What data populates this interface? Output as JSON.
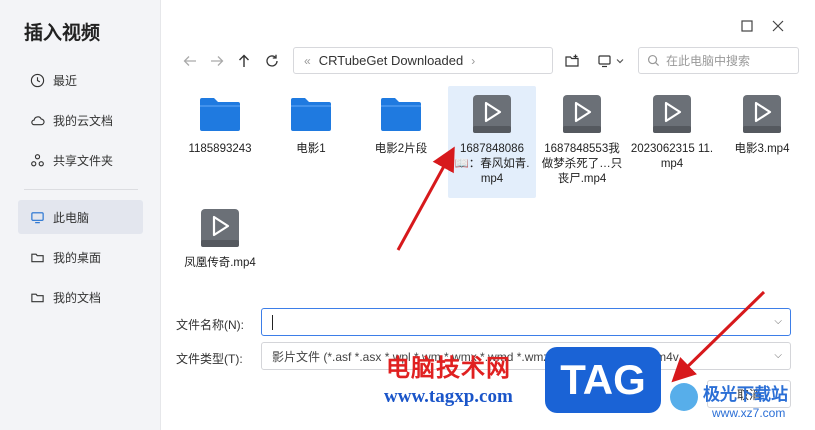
{
  "dialog": {
    "title": "插入视频"
  },
  "sidebar": {
    "items": [
      {
        "label": "最近",
        "icon": "clock-icon"
      },
      {
        "label": "我的云文档",
        "icon": "cloud-icon"
      },
      {
        "label": "共享文件夹",
        "icon": "share-icon"
      },
      {
        "label": "此电脑",
        "icon": "computer-icon",
        "active": true
      },
      {
        "label": "我的桌面",
        "icon": "folder-icon"
      },
      {
        "label": "我的文档",
        "icon": "folder-icon"
      }
    ]
  },
  "toolbar": {
    "path_prefix": "«",
    "path": "CRTubeGet Downloaded",
    "path_suffix": "›",
    "search_placeholder": "在此电脑中搜索"
  },
  "files": [
    {
      "name": "1185893243",
      "type": "folder"
    },
    {
      "name": "电影1",
      "type": "folder"
    },
    {
      "name": "电影2片段",
      "type": "folder"
    },
    {
      "name": "1687848086📖：春风如青.mp4",
      "type": "video",
      "selected": true
    },
    {
      "name": "1687848553我做梦杀死了…只丧尸.mp4",
      "type": "video"
    },
    {
      "name": "2023062315 11.mp4",
      "type": "video"
    },
    {
      "name": "电影3.mp4",
      "type": "video"
    },
    {
      "name": "凤凰传奇.mp4",
      "type": "video"
    }
  ],
  "form": {
    "filename_label": "文件名称(N):",
    "filename_value": "",
    "filetype_label": "文件类型(T):",
    "filetype_value": "影片文件 (*.asf *.asx *.wpl *.wm *.wmx *.wmd *.wmz *.avi *.mov *.mp4 *.m4v"
  },
  "buttons": {
    "cancel": "取消"
  },
  "watermark": {
    "site_name": "电脑技术网",
    "site_url": "www.tagxp.com",
    "logo": "TAG",
    "right_name": "极光下载站",
    "right_url": "www.xz7.com"
  },
  "colors": {
    "accent": "#3d7ee8",
    "folder": "#1f7ae0",
    "video_icon": "#6b7077",
    "selected_bg": "#e3eefb",
    "annotation_arrow": "#d7191c",
    "watermark_red": "#e02020",
    "watermark_blue": "#1a55c9"
  }
}
